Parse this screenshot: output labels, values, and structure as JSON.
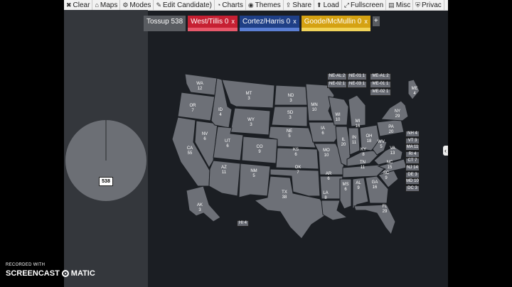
{
  "menu": [
    {
      "label": "Clear",
      "icon": "close-icon",
      "glyph": "✖"
    },
    {
      "label": "Maps",
      "icon": "map-icon",
      "glyph": "⌂"
    },
    {
      "label": "Modes",
      "icon": "gear-icon",
      "glyph": "⚙"
    },
    {
      "label": "Edit Candidate)",
      "icon": "user-edit-icon",
      "glyph": "✎"
    },
    {
      "label": "Charts",
      "icon": "pie-chart-icon",
      "glyph": "◔"
    },
    {
      "label": "Themes",
      "icon": "palette-icon",
      "glyph": "◉"
    },
    {
      "label": "Share",
      "icon": "share-icon",
      "glyph": "⇪"
    },
    {
      "label": "Load",
      "icon": "upload-icon",
      "glyph": "⬆"
    },
    {
      "label": "Fullscreen",
      "icon": "expand-icon",
      "glyph": "⤢"
    },
    {
      "label": "Misc",
      "icon": "file-icon",
      "glyph": "▤"
    },
    {
      "label": "Privac",
      "icon": "shield-icon",
      "glyph": "⛨"
    }
  ],
  "tabs": [
    {
      "label": "Tossup 538",
      "bg": "#595c61",
      "bar": "#595c61",
      "closable": false
    },
    {
      "label": "West/Tillis 0",
      "bg": "#c62032",
      "bar": "#e8596b",
      "closable": true,
      "close": "x"
    },
    {
      "label": "Cortez/Harris 0",
      "bg": "#1f3f86",
      "bar": "#5b7fd4",
      "closable": true,
      "close": "x"
    },
    {
      "label": "Goode/McMullin 0",
      "bg": "#d5a212",
      "bar": "#f1d45a",
      "closable": true,
      "close": "x"
    }
  ],
  "add_tab": "+",
  "pie": {
    "label": "538",
    "value": 538,
    "color": "#6c6f75"
  },
  "collapse": "‹",
  "states": [
    {
      "name": "WA",
      "ev": "12"
    },
    {
      "name": "OR",
      "ev": "7"
    },
    {
      "name": "CA",
      "ev": "55"
    },
    {
      "name": "NV",
      "ev": "6"
    },
    {
      "name": "ID",
      "ev": "4"
    },
    {
      "name": "MT",
      "ev": "3"
    },
    {
      "name": "WY",
      "ev": "3"
    },
    {
      "name": "UT",
      "ev": "6"
    },
    {
      "name": "AZ",
      "ev": "11"
    },
    {
      "name": "CO",
      "ev": "9"
    },
    {
      "name": "NM",
      "ev": "5"
    },
    {
      "name": "ND",
      "ev": "3"
    },
    {
      "name": "SD",
      "ev": "3"
    },
    {
      "name": "NE",
      "ev": "5"
    },
    {
      "name": "KS",
      "ev": "6"
    },
    {
      "name": "OK",
      "ev": "7"
    },
    {
      "name": "TX",
      "ev": "38"
    },
    {
      "name": "MN",
      "ev": "10"
    },
    {
      "name": "IA",
      "ev": "6"
    },
    {
      "name": "MO",
      "ev": "10"
    },
    {
      "name": "AR",
      "ev": "6"
    },
    {
      "name": "LA",
      "ev": "8"
    },
    {
      "name": "WI",
      "ev": "10"
    },
    {
      "name": "IL",
      "ev": "20"
    },
    {
      "name": "MI",
      "ev": "16"
    },
    {
      "name": "IN",
      "ev": "11"
    },
    {
      "name": "OH",
      "ev": "18"
    },
    {
      "name": "KY",
      "ev": "8"
    },
    {
      "name": "TN",
      "ev": "11"
    },
    {
      "name": "MS",
      "ev": "6"
    },
    {
      "name": "AL",
      "ev": "9"
    },
    {
      "name": "GA",
      "ev": "16"
    },
    {
      "name": "FL",
      "ev": "29"
    },
    {
      "name": "SC",
      "ev": "9"
    },
    {
      "name": "NC",
      "ev": "15"
    },
    {
      "name": "VA",
      "ev": "13"
    },
    {
      "name": "WV",
      "ev": "5"
    },
    {
      "name": "PA",
      "ev": "20"
    },
    {
      "name": "NY",
      "ev": "29"
    },
    {
      "name": "ME",
      "ev": "4"
    },
    {
      "name": "AK",
      "ev": "3"
    },
    {
      "name": "HI",
      "ev": "4"
    }
  ],
  "district_boxes": [
    {
      "label": "NE-AL 2"
    },
    {
      "label": "NE-01 1"
    },
    {
      "label": "ME-AL 2"
    },
    {
      "label": "NE-02 1"
    },
    {
      "label": "NE-03 1"
    },
    {
      "label": "ME-01 1"
    },
    {
      "label": "ME-02 1"
    }
  ],
  "small_states": [
    {
      "label": "NH 4"
    },
    {
      "label": "VT 3"
    },
    {
      "label": "MA 11"
    },
    {
      "label": "RI 4"
    },
    {
      "label": "CT 7"
    },
    {
      "label": "NJ 14"
    },
    {
      "label": "DE 3"
    },
    {
      "label": "MD 10"
    },
    {
      "label": "DC 3"
    }
  ],
  "hawaii_box": "HI 4",
  "watermark": {
    "top": "RECORDED WITH",
    "left": "SCREENCAST",
    "right": "MATIC"
  }
}
